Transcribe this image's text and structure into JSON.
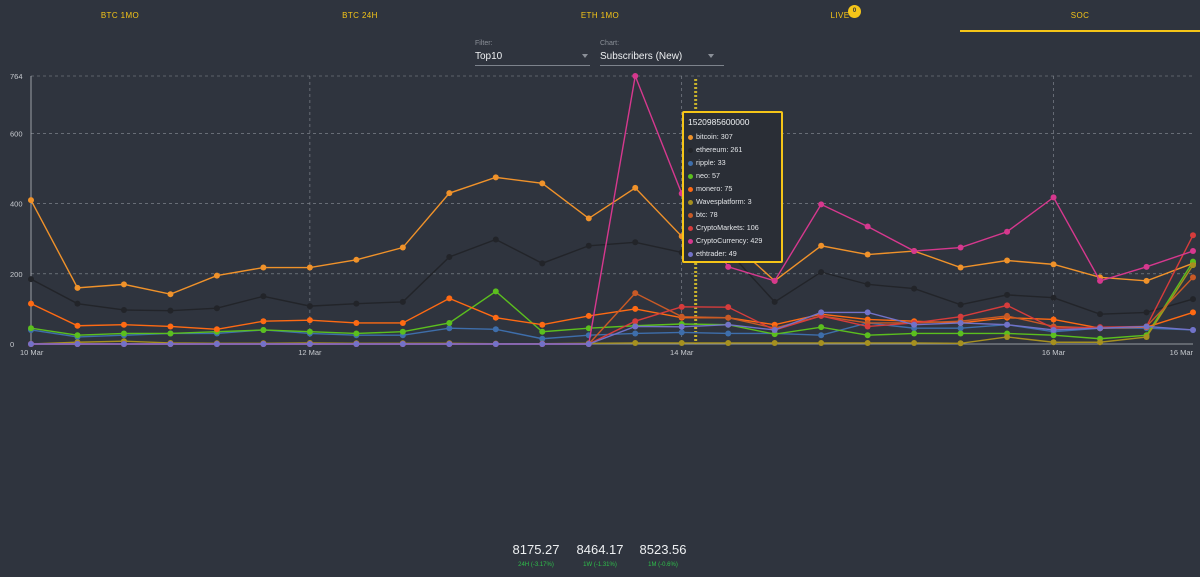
{
  "tabs": [
    {
      "label": "BTC 1MO",
      "active": false
    },
    {
      "label": "BTC 24H",
      "active": false
    },
    {
      "label": "ETH 1MO",
      "active": false
    },
    {
      "label": "LIVE",
      "active": false,
      "badge": "0"
    },
    {
      "label": "SOC",
      "active": true
    }
  ],
  "controls": {
    "filter": {
      "label": "Filter:",
      "value": "Top10"
    },
    "chart": {
      "label": "Chart:",
      "value": "Subscribers (New)"
    }
  },
  "chart_data": {
    "type": "line",
    "ylim": [
      0,
      764
    ],
    "yticks": [
      0,
      200,
      400,
      600,
      764
    ],
    "ytick_labels": [
      "0",
      "200",
      "400",
      "600",
      "764"
    ],
    "x_count": 26,
    "xtick_labels": [
      {
        "label": "10 Mar",
        "index": 0
      },
      {
        "label": "12 Mar",
        "index": 6
      },
      {
        "label": "14 Mar",
        "index": 14
      },
      {
        "label": "16 Mar",
        "index": 22
      },
      {
        "label": "16 Mar",
        "index": 25
      }
    ],
    "vgrid_indices": [
      6,
      14,
      22
    ],
    "highlight_index": 14.3,
    "series": [
      {
        "name": "bitcoin",
        "color": "#f0922a",
        "values": [
          410,
          160,
          170,
          142,
          195,
          218,
          218,
          240,
          275,
          430,
          475,
          458,
          358,
          445,
          307,
          300,
          180,
          280,
          255,
          265,
          218,
          238,
          227,
          190,
          180,
          230
        ]
      },
      {
        "name": "ethereum",
        "color": "#222429",
        "values": [
          185,
          115,
          97,
          95,
          102,
          136,
          108,
          115,
          120,
          248,
          298,
          230,
          280,
          290,
          261,
          265,
          120,
          205,
          170,
          158,
          112,
          140,
          132,
          85,
          90,
          128
        ]
      },
      {
        "name": "ripple",
        "color": "#3e6eab",
        "values": [
          40,
          20,
          25,
          30,
          30,
          40,
          30,
          25,
          25,
          45,
          42,
          15,
          25,
          30,
          33,
          30,
          30,
          25,
          60,
          45,
          45,
          55,
          35,
          45,
          45,
          40
        ]
      },
      {
        "name": "neo",
        "color": "#5bbf1e",
        "values": [
          45,
          25,
          30,
          30,
          35,
          40,
          35,
          30,
          35,
          60,
          150,
          35,
          45,
          52,
          57,
          55,
          28,
          48,
          25,
          30,
          30,
          30,
          25,
          15,
          25,
          235
        ]
      },
      {
        "name": "monero",
        "color": "#ff6a13",
        "values": [
          115,
          52,
          55,
          50,
          42,
          65,
          68,
          60,
          60,
          130,
          75,
          55,
          80,
          100,
          75,
          75,
          55,
          85,
          70,
          65,
          60,
          75,
          70,
          45,
          48,
          90
        ]
      },
      {
        "name": "Wavesplatform",
        "color": "#a6901f",
        "values": [
          0,
          5,
          8,
          3,
          2,
          2,
          3,
          2,
          2,
          2,
          1,
          1,
          2,
          3,
          3,
          3,
          3,
          3,
          3,
          3,
          2,
          20,
          5,
          5,
          20,
          225
        ]
      },
      {
        "name": "btc",
        "color": "#c85a26",
        "values": [
          0,
          0,
          0,
          0,
          0,
          0,
          0,
          0,
          0,
          0,
          0,
          0,
          0,
          145,
          78,
          75,
          45,
          80,
          60,
          60,
          65,
          80,
          50,
          45,
          50,
          190
        ]
      },
      {
        "name": "CryptoMarkets",
        "color": "#d63c3c",
        "values": [
          0,
          0,
          0,
          0,
          0,
          0,
          0,
          0,
          0,
          0,
          0,
          0,
          0,
          65,
          106,
          105,
          40,
          80,
          50,
          60,
          78,
          110,
          45,
          48,
          50,
          310
        ]
      },
      {
        "name": "CryptoCurrency",
        "color": "#d6388e",
        "values": [
          0,
          0,
          0,
          0,
          0,
          0,
          0,
          0,
          0,
          0,
          0,
          0,
          0,
          764,
          429,
          220,
          180,
          398,
          335,
          265,
          275,
          320,
          418,
          180,
          220,
          265
        ]
      },
      {
        "name": "ethtrader",
        "color": "#7272c8",
        "values": [
          0,
          0,
          0,
          0,
          0,
          0,
          0,
          0,
          0,
          0,
          0,
          0,
          0,
          50,
          49,
          55,
          40,
          90,
          90,
          55,
          60,
          55,
          40,
          45,
          50,
          40
        ]
      }
    ]
  },
  "tooltip": {
    "title": "1520985600000",
    "rows": [
      {
        "text": "bitcoin: 307",
        "color": "#f0922a"
      },
      {
        "text": "ethereum: 261",
        "color": "#222429"
      },
      {
        "text": "ripple: 33",
        "color": "#3e6eab"
      },
      {
        "text": "neo: 57",
        "color": "#5bbf1e"
      },
      {
        "text": "monero: 75",
        "color": "#ff6a13"
      },
      {
        "text": "Wavesplatform: 3",
        "color": "#a6901f"
      },
      {
        "text": "btc: 78",
        "color": "#c85a26"
      },
      {
        "text": "CryptoMarkets: 106",
        "color": "#d63c3c"
      },
      {
        "text": "CryptoCurrency: 429",
        "color": "#d6388e"
      },
      {
        "text": "ethtrader: 49",
        "color": "#7272c8"
      }
    ]
  },
  "prices": [
    {
      "value": "8175.27",
      "change": "24H (-3.17%)"
    },
    {
      "value": "8464.17",
      "change": "1W (-1.31%)"
    },
    {
      "value": "8523.56",
      "change": "1M (-0.6%)"
    }
  ]
}
